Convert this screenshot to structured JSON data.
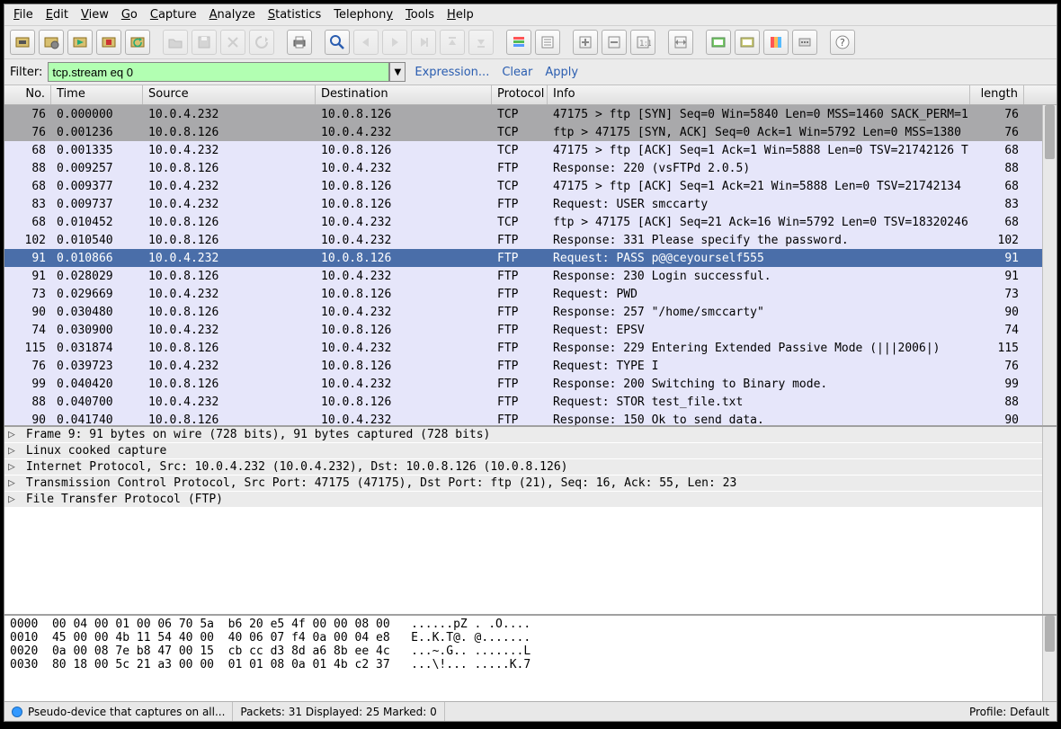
{
  "menu": {
    "file": "File",
    "edit": "Edit",
    "view": "View",
    "go": "Go",
    "capture": "Capture",
    "analyze": "Analyze",
    "statistics": "Statistics",
    "telephony": "Telephony",
    "tools": "Tools",
    "help": "Help"
  },
  "filter": {
    "label": "Filter:",
    "value": "tcp.stream eq 0",
    "expression": "Expression...",
    "clear": "Clear",
    "apply": "Apply"
  },
  "columns": {
    "no": "No.",
    "time": "Time",
    "src": "Source",
    "dst": "Destination",
    "proto": "Protocol",
    "info": "Info",
    "len": "length"
  },
  "packets": [
    {
      "no": "76",
      "time": "0.000000",
      "src": "10.0.4.232",
      "dst": "10.0.8.126",
      "proto": "TCP",
      "info": "47175 > ftp [SYN] Seq=0 Win=5840 Len=0 MSS=1460 SACK_PERM=1",
      "len": "76",
      "cls": "gray"
    },
    {
      "no": "76",
      "time": "0.001236",
      "src": "10.0.8.126",
      "dst": "10.0.4.232",
      "proto": "TCP",
      "info": "ftp > 47175 [SYN, ACK] Seq=0 Ack=1 Win=5792 Len=0 MSS=1380",
      "len": "76",
      "cls": "gray"
    },
    {
      "no": "68",
      "time": "0.001335",
      "src": "10.0.4.232",
      "dst": "10.0.8.126",
      "proto": "TCP",
      "info": "47175 > ftp [ACK] Seq=1 Ack=1 Win=5888 Len=0 TSV=21742126 T",
      "len": "68",
      "cls": "lav"
    },
    {
      "no": "88",
      "time": "0.009257",
      "src": "10.0.8.126",
      "dst": "10.0.4.232",
      "proto": "FTP",
      "info": "Response: 220 (vsFTPd 2.0.5)",
      "len": "88",
      "cls": "lav"
    },
    {
      "no": "68",
      "time": "0.009377",
      "src": "10.0.4.232",
      "dst": "10.0.8.126",
      "proto": "TCP",
      "info": "47175 > ftp [ACK] Seq=1 Ack=21 Win=5888 Len=0 TSV=21742134",
      "len": "68",
      "cls": "lav"
    },
    {
      "no": "83",
      "time": "0.009737",
      "src": "10.0.4.232",
      "dst": "10.0.8.126",
      "proto": "FTP",
      "info": "Request: USER smccarty",
      "len": "83",
      "cls": "lav"
    },
    {
      "no": "68",
      "time": "0.010452",
      "src": "10.0.8.126",
      "dst": "10.0.4.232",
      "proto": "TCP",
      "info": "ftp > 47175 [ACK] Seq=21 Ack=16 Win=5792 Len=0 TSV=18320246",
      "len": "68",
      "cls": "lav"
    },
    {
      "no": "102",
      "time": "0.010540",
      "src": "10.0.8.126",
      "dst": "10.0.4.232",
      "proto": "FTP",
      "info": "Response: 331 Please specify the password.",
      "len": "102",
      "cls": "lav"
    },
    {
      "no": "91",
      "time": "0.010866",
      "src": "10.0.4.232",
      "dst": "10.0.8.126",
      "proto": "FTP",
      "info": "Request: PASS p@@ceyourself555",
      "len": "91",
      "cls": "sel"
    },
    {
      "no": "91",
      "time": "0.028029",
      "src": "10.0.8.126",
      "dst": "10.0.4.232",
      "proto": "FTP",
      "info": "Response: 230 Login successful.",
      "len": "91",
      "cls": "lav"
    },
    {
      "no": "73",
      "time": "0.029669",
      "src": "10.0.4.232",
      "dst": "10.0.8.126",
      "proto": "FTP",
      "info": "Request: PWD",
      "len": "73",
      "cls": "lav"
    },
    {
      "no": "90",
      "time": "0.030480",
      "src": "10.0.8.126",
      "dst": "10.0.4.232",
      "proto": "FTP",
      "info": "Response: 257 \"/home/smccarty\"",
      "len": "90",
      "cls": "lav"
    },
    {
      "no": "74",
      "time": "0.030900",
      "src": "10.0.4.232",
      "dst": "10.0.8.126",
      "proto": "FTP",
      "info": "Request: EPSV",
      "len": "74",
      "cls": "lav"
    },
    {
      "no": "115",
      "time": "0.031874",
      "src": "10.0.8.126",
      "dst": "10.0.4.232",
      "proto": "FTP",
      "info": "Response: 229 Entering Extended Passive Mode (|||2006|)",
      "len": "115",
      "cls": "lav"
    },
    {
      "no": "76",
      "time": "0.039723",
      "src": "10.0.4.232",
      "dst": "10.0.8.126",
      "proto": "FTP",
      "info": "Request: TYPE I",
      "len": "76",
      "cls": "lav"
    },
    {
      "no": "99",
      "time": "0.040420",
      "src": "10.0.8.126",
      "dst": "10.0.4.232",
      "proto": "FTP",
      "info": "Response: 200 Switching to Binary mode.",
      "len": "99",
      "cls": "lav"
    },
    {
      "no": "88",
      "time": "0.040700",
      "src": "10.0.4.232",
      "dst": "10.0.8.126",
      "proto": "FTP",
      "info": "Request: STOR test_file.txt",
      "len": "88",
      "cls": "lav"
    },
    {
      "no": "90",
      "time": "0.041740",
      "src": "10.0.8.126",
      "dst": "10.0.4.232",
      "proto": "FTP",
      "info": "Response: 150 Ok to send data.",
      "len": "90",
      "cls": "lav"
    }
  ],
  "details": [
    "Frame 9: 91 bytes on wire (728 bits), 91 bytes captured (728 bits)",
    "Linux cooked capture",
    "Internet Protocol, Src: 10.0.4.232 (10.0.4.232), Dst: 10.0.8.126 (10.0.8.126)",
    "Transmission Control Protocol, Src Port: 47175 (47175), Dst Port: ftp (21), Seq: 16, Ack: 55, Len: 23",
    "File Transfer Protocol (FTP)"
  ],
  "hex": [
    "0000  00 04 00 01 00 06 70 5a  b6 20 e5 4f 00 00 08 00   ......pZ . .O....",
    "0010  45 00 00 4b 11 54 40 00  40 06 07 f4 0a 00 04 e8   E..K.T@. @.......",
    "0020  0a 00 08 7e b8 47 00 15  cb cc d3 8d a6 8b ee 4c   ...~.G.. .......L",
    "0030  80 18 00 5c 21 a3 00 00  01 01 08 0a 01 4b c2 37   ...\\!... .....K.7"
  ],
  "status": {
    "dev": "Pseudo-device that captures on all...",
    "stats": "Packets: 31 Displayed: 25 Marked: 0",
    "profile": "Profile: Default"
  }
}
